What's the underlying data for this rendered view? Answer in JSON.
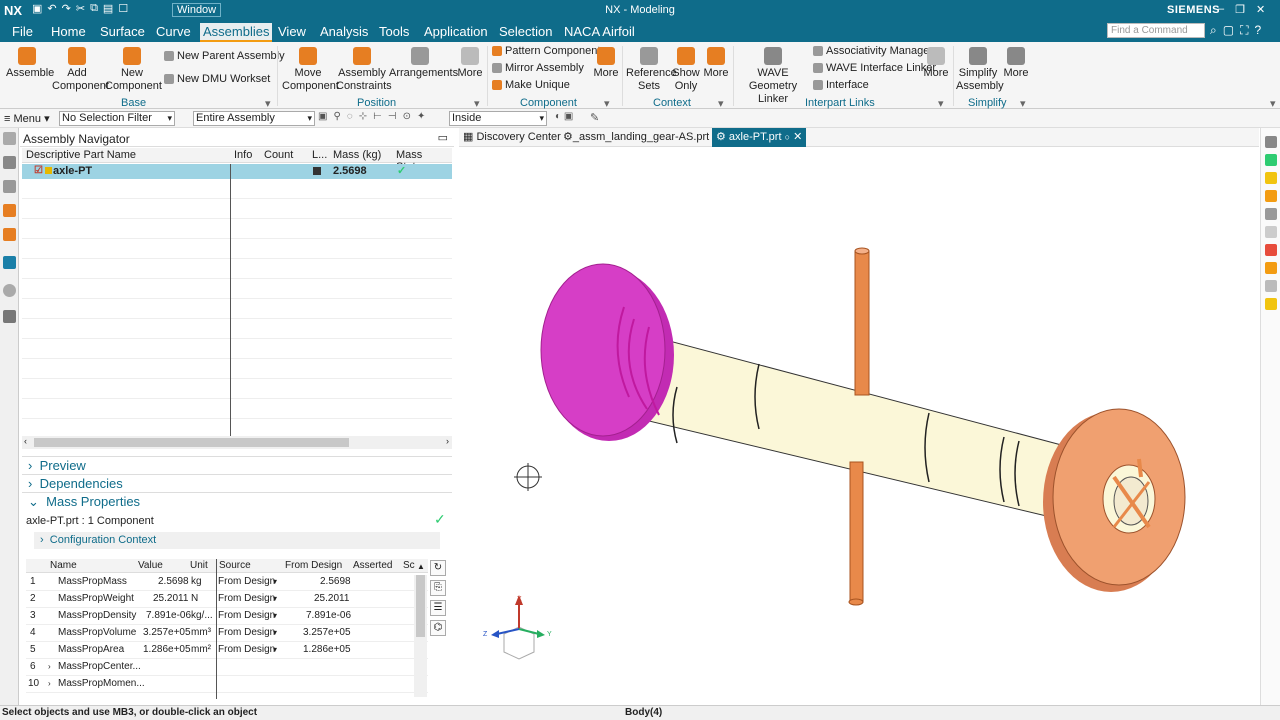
{
  "titlebar": {
    "app": "NX",
    "window_menu": "Window",
    "title": "NX - Modeling",
    "brand": "SIEMENS"
  },
  "menubar": {
    "tabs": [
      "File",
      "Home",
      "Surface",
      "Curve",
      "Assemblies",
      "View",
      "Analysis",
      "Tools",
      "Application",
      "Selection",
      "NACA Airfoil"
    ],
    "active": "Assemblies",
    "find_placeholder": "Find a Command"
  },
  "ribbon": {
    "base": {
      "assemble": "Assemble",
      "add_component": [
        "Add",
        "Component"
      ],
      "new_component": [
        "New",
        "Component"
      ],
      "new_parent": "New Parent Assembly",
      "new_dmu": "New DMU Workset",
      "label": "Base"
    },
    "position": {
      "move": [
        "Move",
        "Component"
      ],
      "constraints": [
        "Assembly",
        "Constraints"
      ],
      "arrangements": "Arrangements",
      "more": "More",
      "label": "Position"
    },
    "component": {
      "pattern": "Pattern Component",
      "mirror": "Mirror Assembly",
      "make_unique": "Make Unique",
      "more": "More",
      "label": "Component"
    },
    "context": {
      "reference": [
        "Reference",
        "Sets"
      ],
      "show_only": [
        "Show",
        "Only"
      ],
      "more": "More",
      "label": "Context"
    },
    "interpart": {
      "wave_linker": [
        "WAVE",
        "Geometry Linker"
      ],
      "assoc_mgr": "Associativity Manager",
      "wave_iface": "WAVE Interface Linker",
      "interface": "Interface",
      "more": "More",
      "label": "Interpart Links"
    },
    "simplify": {
      "simplify": [
        "Simplify",
        "Assembly"
      ],
      "more": "More",
      "label": "Simplify"
    }
  },
  "toolbar": {
    "menu": "Menu",
    "filter": "No Selection Filter",
    "scope": "Entire Assembly",
    "inside": "Inside"
  },
  "navigator": {
    "title": "Assembly Navigator",
    "columns": [
      "Descriptive Part Name",
      "Info",
      "Count",
      "L...",
      "Mass (kg)",
      "Mass Status"
    ],
    "row": {
      "name": "axle-PT",
      "mass": "2.5698",
      "status": "✓"
    },
    "sections": [
      "Preview",
      "Dependencies",
      "Mass Properties"
    ],
    "mass_summary": "axle-PT.prt : 1 Component",
    "config": "Configuration Context",
    "table": {
      "headers": [
        "Name",
        "Value",
        "Unit",
        "Source",
        "From Design",
        "Asserted",
        "Sc"
      ],
      "rows": [
        [
          "1",
          "MassPropMass",
          "2.5698",
          "kg",
          "From Design",
          "2.5698"
        ],
        [
          "2",
          "MassPropWeight",
          "25.2011",
          "N",
          "From Design",
          "25.2011"
        ],
        [
          "3",
          "MassPropDensity",
          "7.891e-06",
          "kg/...",
          "From Design",
          "7.891e-06"
        ],
        [
          "4",
          "MassPropVolume",
          "3.257e+05",
          "mm³",
          "From Design",
          "3.257e+05"
        ],
        [
          "5",
          "MassPropArea",
          "1.286e+05",
          "mm²",
          "From Design",
          "1.286e+05"
        ],
        [
          "6",
          "MassPropCenter...",
          "",
          "",
          "",
          ""
        ],
        [
          "10",
          "MassPropMomen...",
          "",
          "",
          "",
          ""
        ]
      ]
    }
  },
  "view_tabs": [
    "Discovery Center",
    "_assm_landing_gear-AS.prt",
    "axle-PT.prt"
  ],
  "status": {
    "left": "Select objects and use MB3, or double-click an object",
    "center": "Body(4)"
  },
  "colors": {
    "accent": "#0f6c8a",
    "flange_left": "#d63ec6",
    "flange_right": "#f0a070",
    "shaft": "#fbf7d8",
    "pin": "#e8894a"
  }
}
